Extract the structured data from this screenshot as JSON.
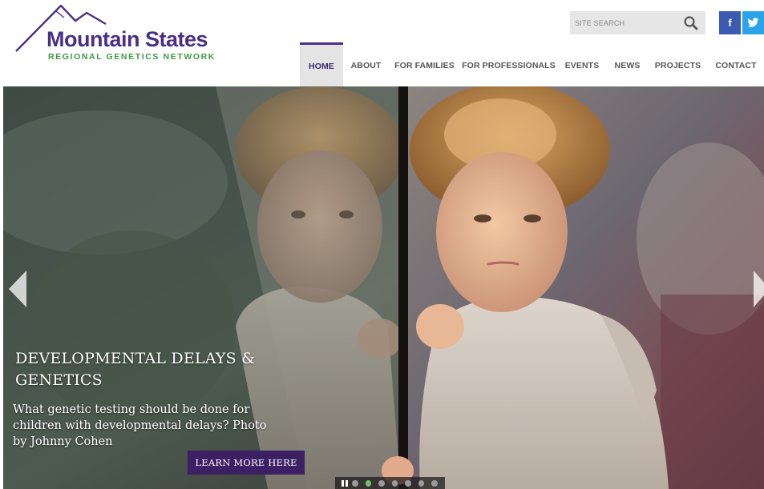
{
  "logo": {
    "title": "Mountain States",
    "subtitle": "REGIONAL GENETICS NETWORK",
    "brand_purple": "#4b2f86",
    "brand_green": "#3d9a43"
  },
  "search": {
    "placeholder": "SITE SEARCH",
    "icon": "search-icon"
  },
  "social": {
    "facebook": {
      "icon": "facebook-icon",
      "label": "f",
      "color": "#3b5ab0"
    },
    "twitter": {
      "icon": "twitter-icon",
      "color": "#2aa3e8"
    }
  },
  "nav": {
    "items": [
      {
        "label": "HOME",
        "active": true
      },
      {
        "label": "ABOUT"
      },
      {
        "label": "FOR FAMILIES"
      },
      {
        "label": "FOR PROFESSIONALS"
      },
      {
        "label": "EVENTS"
      },
      {
        "label": "NEWS"
      },
      {
        "label": "PROJECTS"
      },
      {
        "label": "CONTACT"
      }
    ]
  },
  "hero": {
    "title": "DEVELOPMENTAL DELAYS & GENETICS",
    "caption": "What genetic testing should be done for children with developmental delays? Photo by Johnny Cohen",
    "cta_label": "LEARN MORE HERE",
    "cta_color": "#3d1f63",
    "slider": {
      "slide_count": 7,
      "active_slide": 2,
      "active_color": "#6fc067"
    }
  }
}
